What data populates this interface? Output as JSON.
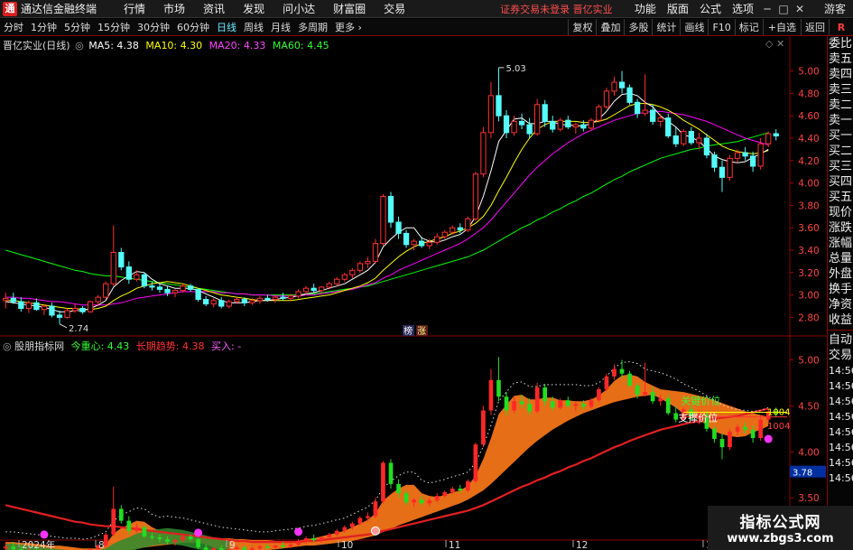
{
  "app": {
    "logo_char": "通",
    "name": "通达信金融终端"
  },
  "menu": [
    "行情",
    "市场",
    "资讯",
    "发现",
    "问小达",
    "财富圈",
    "交易"
  ],
  "notice": "证券交易未登录  晋亿实业",
  "right_menu": [
    "功能",
    "版面",
    "公式",
    "选项"
  ],
  "window_buttons": [
    "─",
    "□",
    "✕"
  ],
  "guest": "游客",
  "periods": [
    "分时",
    "1分钟",
    "5分钟",
    "15分钟",
    "30分钟",
    "60分钟",
    "日线",
    "周线",
    "月线",
    "多周期",
    "更多 ›"
  ],
  "active_period": "日线",
  "toolbar_right": [
    "复权",
    "叠加",
    "多股",
    "统计",
    "画线",
    "F10",
    "标记",
    "+自选",
    "返回"
  ],
  "r_marker": "R",
  "main_header": {
    "title": "晋亿实业(日线)",
    "ma5": "MA5: 4.38",
    "ma10": "MA10: 4.30",
    "ma20": "MA20: 4.33",
    "ma60": "MA60: 4.45",
    "colors": {
      "ma5": "#ffffff",
      "ma10": "#ffff00",
      "ma20": "#ff00ff",
      "ma60": "#00ff00"
    }
  },
  "sub_header": {
    "title": "股朋指标网",
    "center": "今重心: 4.43",
    "trend": "长期趋势: 4.38",
    "buy": "买入: -"
  },
  "annotations": {
    "high_label": "5.03",
    "low_label": "2.74",
    "badge1": "榜",
    "badge2": "涨",
    "key_price": "关键价位",
    "support_price": "支撑价位",
    "val1": "1004",
    "val2": "1004",
    "current_label": "3.78"
  },
  "dates": [
    "2024年",
    "8",
    "9",
    "10",
    "11",
    "12",
    "1"
  ],
  "chart_data": {
    "type": "candlestick",
    "title": "晋亿实业(日线)",
    "main_y_ticks": [
      5.0,
      4.8,
      4.6,
      4.4,
      4.2,
      4.0,
      3.8,
      3.6,
      3.4,
      3.2,
      3.0,
      2.8
    ],
    "main_ylim": [
      2.65,
      5.15
    ],
    "sub_y_ticks": [
      5.0,
      4.5,
      4.0,
      3.5
    ],
    "sub_ylim": [
      3.05,
      5.25
    ],
    "ohlc": [
      [
        2.95,
        3.02,
        2.88,
        2.97
      ],
      [
        2.97,
        3.02,
        2.92,
        2.94
      ],
      [
        2.94,
        2.98,
        2.85,
        2.88
      ],
      [
        2.88,
        2.95,
        2.84,
        2.93
      ],
      [
        2.93,
        2.97,
        2.86,
        2.87
      ],
      [
        2.87,
        2.92,
        2.82,
        2.9
      ],
      [
        2.9,
        2.93,
        2.8,
        2.82
      ],
      [
        2.82,
        2.86,
        2.74,
        2.8
      ],
      [
        2.8,
        2.88,
        2.79,
        2.86
      ],
      [
        2.86,
        2.92,
        2.84,
        2.88
      ],
      [
        2.88,
        2.9,
        2.83,
        2.85
      ],
      [
        2.85,
        2.95,
        2.84,
        2.94
      ],
      [
        2.94,
        3.0,
        2.9,
        2.98
      ],
      [
        2.98,
        3.12,
        2.96,
        3.1
      ],
      [
        3.1,
        3.62,
        3.08,
        3.38
      ],
      [
        3.38,
        3.42,
        3.22,
        3.25
      ],
      [
        3.25,
        3.3,
        3.1,
        3.14
      ],
      [
        3.14,
        3.22,
        3.12,
        3.18
      ],
      [
        3.18,
        3.2,
        3.06,
        3.08
      ],
      [
        3.08,
        3.12,
        3.04,
        3.07
      ],
      [
        3.07,
        3.1,
        3.02,
        3.05
      ],
      [
        3.05,
        3.08,
        2.99,
        3.02
      ],
      [
        3.02,
        3.05,
        2.98,
        3.04
      ],
      [
        3.04,
        3.1,
        3.02,
        3.08
      ],
      [
        3.08,
        3.1,
        3.03,
        3.05
      ],
      [
        3.05,
        3.06,
        2.94,
        2.96
      ],
      [
        2.96,
        2.99,
        2.9,
        2.92
      ],
      [
        2.92,
        2.97,
        2.89,
        2.95
      ],
      [
        2.95,
        2.98,
        2.88,
        2.9
      ],
      [
        2.9,
        2.96,
        2.88,
        2.94
      ],
      [
        2.94,
        2.98,
        2.92,
        2.96
      ],
      [
        2.96,
        2.98,
        2.9,
        2.93
      ],
      [
        2.93,
        2.97,
        2.91,
        2.95
      ],
      [
        2.95,
        2.99,
        2.92,
        2.97
      ],
      [
        2.97,
        3.0,
        2.94,
        2.96
      ],
      [
        2.96,
        2.99,
        2.93,
        2.98
      ],
      [
        2.98,
        3.02,
        2.95,
        2.97
      ],
      [
        2.97,
        3.01,
        2.95,
        2.99
      ],
      [
        2.99,
        3.05,
        2.97,
        3.03
      ],
      [
        3.03,
        3.08,
        3.0,
        3.06
      ],
      [
        3.06,
        3.1,
        3.02,
        3.04
      ],
      [
        3.04,
        3.08,
        3.01,
        3.07
      ],
      [
        3.07,
        3.12,
        3.05,
        3.1
      ],
      [
        3.1,
        3.16,
        3.08,
        3.14
      ],
      [
        3.14,
        3.2,
        3.12,
        3.18
      ],
      [
        3.18,
        3.24,
        3.15,
        3.22
      ],
      [
        3.22,
        3.3,
        3.2,
        3.28
      ],
      [
        3.28,
        3.34,
        3.24,
        3.3
      ],
      [
        3.3,
        3.5,
        3.28,
        3.46
      ],
      [
        3.46,
        3.9,
        3.44,
        3.88
      ],
      [
        3.88,
        3.92,
        3.6,
        3.65
      ],
      [
        3.65,
        3.7,
        3.5,
        3.55
      ],
      [
        3.55,
        3.58,
        3.42,
        3.45
      ],
      [
        3.45,
        3.5,
        3.4,
        3.48
      ],
      [
        3.48,
        3.52,
        3.42,
        3.44
      ],
      [
        3.44,
        3.5,
        3.41,
        3.47
      ],
      [
        3.47,
        3.55,
        3.45,
        3.52
      ],
      [
        3.52,
        3.58,
        3.5,
        3.56
      ],
      [
        3.56,
        3.62,
        3.54,
        3.6
      ],
      [
        3.6,
        3.64,
        3.55,
        3.58
      ],
      [
        3.58,
        3.7,
        3.56,
        3.68
      ],
      [
        3.68,
        4.1,
        3.66,
        4.08
      ],
      [
        4.08,
        4.5,
        4.05,
        4.45
      ],
      [
        4.45,
        4.9,
        4.4,
        4.78
      ],
      [
        4.78,
        5.03,
        4.55,
        4.6
      ],
      [
        4.6,
        4.65,
        4.4,
        4.45
      ],
      [
        4.45,
        4.6,
        4.42,
        4.55
      ],
      [
        4.55,
        4.62,
        4.48,
        4.52
      ],
      [
        4.52,
        4.58,
        4.4,
        4.44
      ],
      [
        4.44,
        4.75,
        4.42,
        4.7
      ],
      [
        4.7,
        4.74,
        4.5,
        4.55
      ],
      [
        4.55,
        4.6,
        4.45,
        4.48
      ],
      [
        4.48,
        4.58,
        4.46,
        4.56
      ],
      [
        4.56,
        4.6,
        4.48,
        4.5
      ],
      [
        4.5,
        4.54,
        4.44,
        4.52
      ],
      [
        4.52,
        4.56,
        4.46,
        4.49
      ],
      [
        4.49,
        4.58,
        4.47,
        4.56
      ],
      [
        4.56,
        4.7,
        4.54,
        4.68
      ],
      [
        4.68,
        4.85,
        4.66,
        4.82
      ],
      [
        4.82,
        4.95,
        4.78,
        4.9
      ],
      [
        4.9,
        5.0,
        4.8,
        4.85
      ],
      [
        4.85,
        4.88,
        4.7,
        4.72
      ],
      [
        4.72,
        4.75,
        4.58,
        4.62
      ],
      [
        4.62,
        4.97,
        4.6,
        4.65
      ],
      [
        4.65,
        4.7,
        4.52,
        4.55
      ],
      [
        4.55,
        4.62,
        4.5,
        4.58
      ],
      [
        4.58,
        4.62,
        4.4,
        4.42
      ],
      [
        4.42,
        4.5,
        4.32,
        4.35
      ],
      [
        4.35,
        4.48,
        4.33,
        4.46
      ],
      [
        4.46,
        4.5,
        4.34,
        4.36
      ],
      [
        4.36,
        4.45,
        4.3,
        4.4
      ],
      [
        4.4,
        4.44,
        4.22,
        4.25
      ],
      [
        4.25,
        4.28,
        4.1,
        4.14
      ],
      [
        4.14,
        4.2,
        3.92,
        4.05
      ],
      [
        4.05,
        4.25,
        4.02,
        4.22
      ],
      [
        4.22,
        4.3,
        4.18,
        4.27
      ],
      [
        4.27,
        4.32,
        4.2,
        4.24
      ],
      [
        4.24,
        4.28,
        4.1,
        4.15
      ],
      [
        4.15,
        4.4,
        4.12,
        4.35
      ],
      [
        4.35,
        4.46,
        4.32,
        4.44
      ],
      [
        4.44,
        4.48,
        4.38,
        4.42
      ]
    ],
    "ma5": [
      2.94,
      2.93,
      2.92,
      2.91,
      2.9,
      2.89,
      2.87,
      2.85,
      2.85,
      2.86,
      2.86,
      2.88,
      2.91,
      2.95,
      3.07,
      3.13,
      3.17,
      3.21,
      3.2,
      3.14,
      3.1,
      3.08,
      3.06,
      3.06,
      3.06,
      3.04,
      3.01,
      2.98,
      2.95,
      2.93,
      2.93,
      2.93,
      2.94,
      2.95,
      2.95,
      2.96,
      2.97,
      2.98,
      2.99,
      3.01,
      3.02,
      3.04,
      3.06,
      3.08,
      3.1,
      3.14,
      3.18,
      3.22,
      3.29,
      3.43,
      3.5,
      3.56,
      3.6,
      3.6,
      3.51,
      3.48,
      3.47,
      3.49,
      3.52,
      3.54,
      3.59,
      3.7,
      3.88,
      4.11,
      4.37,
      4.47,
      4.57,
      4.58,
      4.53,
      4.53,
      4.55,
      4.55,
      4.52,
      4.52,
      4.51,
      4.51,
      4.53,
      4.57,
      4.64,
      4.73,
      4.79,
      4.8,
      4.78,
      4.72,
      4.68,
      4.6,
      4.55,
      4.5,
      4.43,
      4.41,
      4.37,
      4.31,
      4.24,
      4.21,
      4.19,
      4.18,
      4.19,
      4.23,
      4.26,
      4.3
    ],
    "ma10": [
      2.95,
      2.95,
      2.94,
      2.93,
      2.92,
      2.91,
      2.9,
      2.89,
      2.88,
      2.88,
      2.87,
      2.87,
      2.88,
      2.9,
      2.95,
      2.99,
      3.02,
      3.06,
      3.08,
      3.1,
      3.11,
      3.12,
      3.11,
      3.1,
      3.08,
      3.06,
      3.04,
      3.02,
      3.0,
      2.99,
      2.98,
      2.97,
      2.96,
      2.95,
      2.95,
      2.95,
      2.95,
      2.95,
      2.96,
      2.97,
      2.98,
      2.99,
      3.0,
      3.02,
      3.04,
      3.06,
      3.08,
      3.11,
      3.15,
      3.22,
      3.28,
      3.34,
      3.39,
      3.43,
      3.46,
      3.48,
      3.5,
      3.52,
      3.55,
      3.57,
      3.6,
      3.64,
      3.7,
      3.8,
      3.93,
      4.05,
      4.18,
      4.3,
      4.4,
      4.48,
      4.52,
      4.55,
      4.55,
      4.55,
      4.55,
      4.54,
      4.54,
      4.55,
      4.57,
      4.61,
      4.65,
      4.69,
      4.71,
      4.71,
      4.7,
      4.68,
      4.65,
      4.61,
      4.56,
      4.52,
      4.48,
      4.43,
      4.38,
      4.33,
      4.3,
      4.28,
      4.27,
      4.26,
      4.27,
      4.29
    ],
    "ma20": [
      2.98,
      2.98,
      2.97,
      2.97,
      2.96,
      2.95,
      2.94,
      2.94,
      2.93,
      2.92,
      2.91,
      2.91,
      2.91,
      2.91,
      2.92,
      2.93,
      2.95,
      2.97,
      2.98,
      2.99,
      3.0,
      3.01,
      3.02,
      3.03,
      3.03,
      3.03,
      3.03,
      3.03,
      3.02,
      3.02,
      3.01,
      3.01,
      3.0,
      3.0,
      3.0,
      2.99,
      2.99,
      2.99,
      2.99,
      3.0,
      3.0,
      3.01,
      3.02,
      3.03,
      3.04,
      3.05,
      3.07,
      3.09,
      3.11,
      3.15,
      3.18,
      3.22,
      3.25,
      3.28,
      3.31,
      3.34,
      3.37,
      3.4,
      3.43,
      3.46,
      3.5,
      3.55,
      3.6,
      3.67,
      3.75,
      3.83,
      3.91,
      3.99,
      4.07,
      4.14,
      4.2,
      4.26,
      4.31,
      4.36,
      4.4,
      4.44,
      4.47,
      4.5,
      4.53,
      4.56,
      4.58,
      4.6,
      4.62,
      4.63,
      4.64,
      4.64,
      4.63,
      4.62,
      4.61,
      4.59,
      4.57,
      4.55,
      4.52,
      4.49,
      4.46,
      4.43,
      4.4,
      4.38,
      4.36,
      4.34
    ],
    "ma60": [
      3.4,
      3.38,
      3.36,
      3.34,
      3.32,
      3.3,
      3.28,
      3.26,
      3.24,
      3.22,
      3.21,
      3.19,
      3.18,
      3.17,
      3.17,
      3.16,
      3.15,
      3.14,
      3.13,
      3.12,
      3.11,
      3.1,
      3.09,
      3.08,
      3.07,
      3.06,
      3.05,
      3.04,
      3.03,
      3.02,
      3.01,
      3.01,
      3.0,
      3.0,
      3.0,
      3.0,
      3.0,
      3.0,
      3.0,
      3.01,
      3.01,
      3.02,
      3.03,
      3.04,
      3.05,
      3.06,
      3.07,
      3.08,
      3.1,
      3.12,
      3.14,
      3.16,
      3.18,
      3.2,
      3.22,
      3.24,
      3.26,
      3.28,
      3.3,
      3.32,
      3.34,
      3.37,
      3.4,
      3.44,
      3.48,
      3.52,
      3.56,
      3.6,
      3.63,
      3.67,
      3.7,
      3.74,
      3.77,
      3.81,
      3.84,
      3.88,
      3.91,
      3.95,
      3.99,
      4.03,
      4.06,
      4.1,
      4.13,
      4.16,
      4.19,
      4.22,
      4.24,
      4.26,
      4.28,
      4.3,
      4.31,
      4.33,
      4.34,
      4.35,
      4.36,
      4.37,
      4.39,
      4.41,
      4.43,
      4.45
    ]
  }
}
